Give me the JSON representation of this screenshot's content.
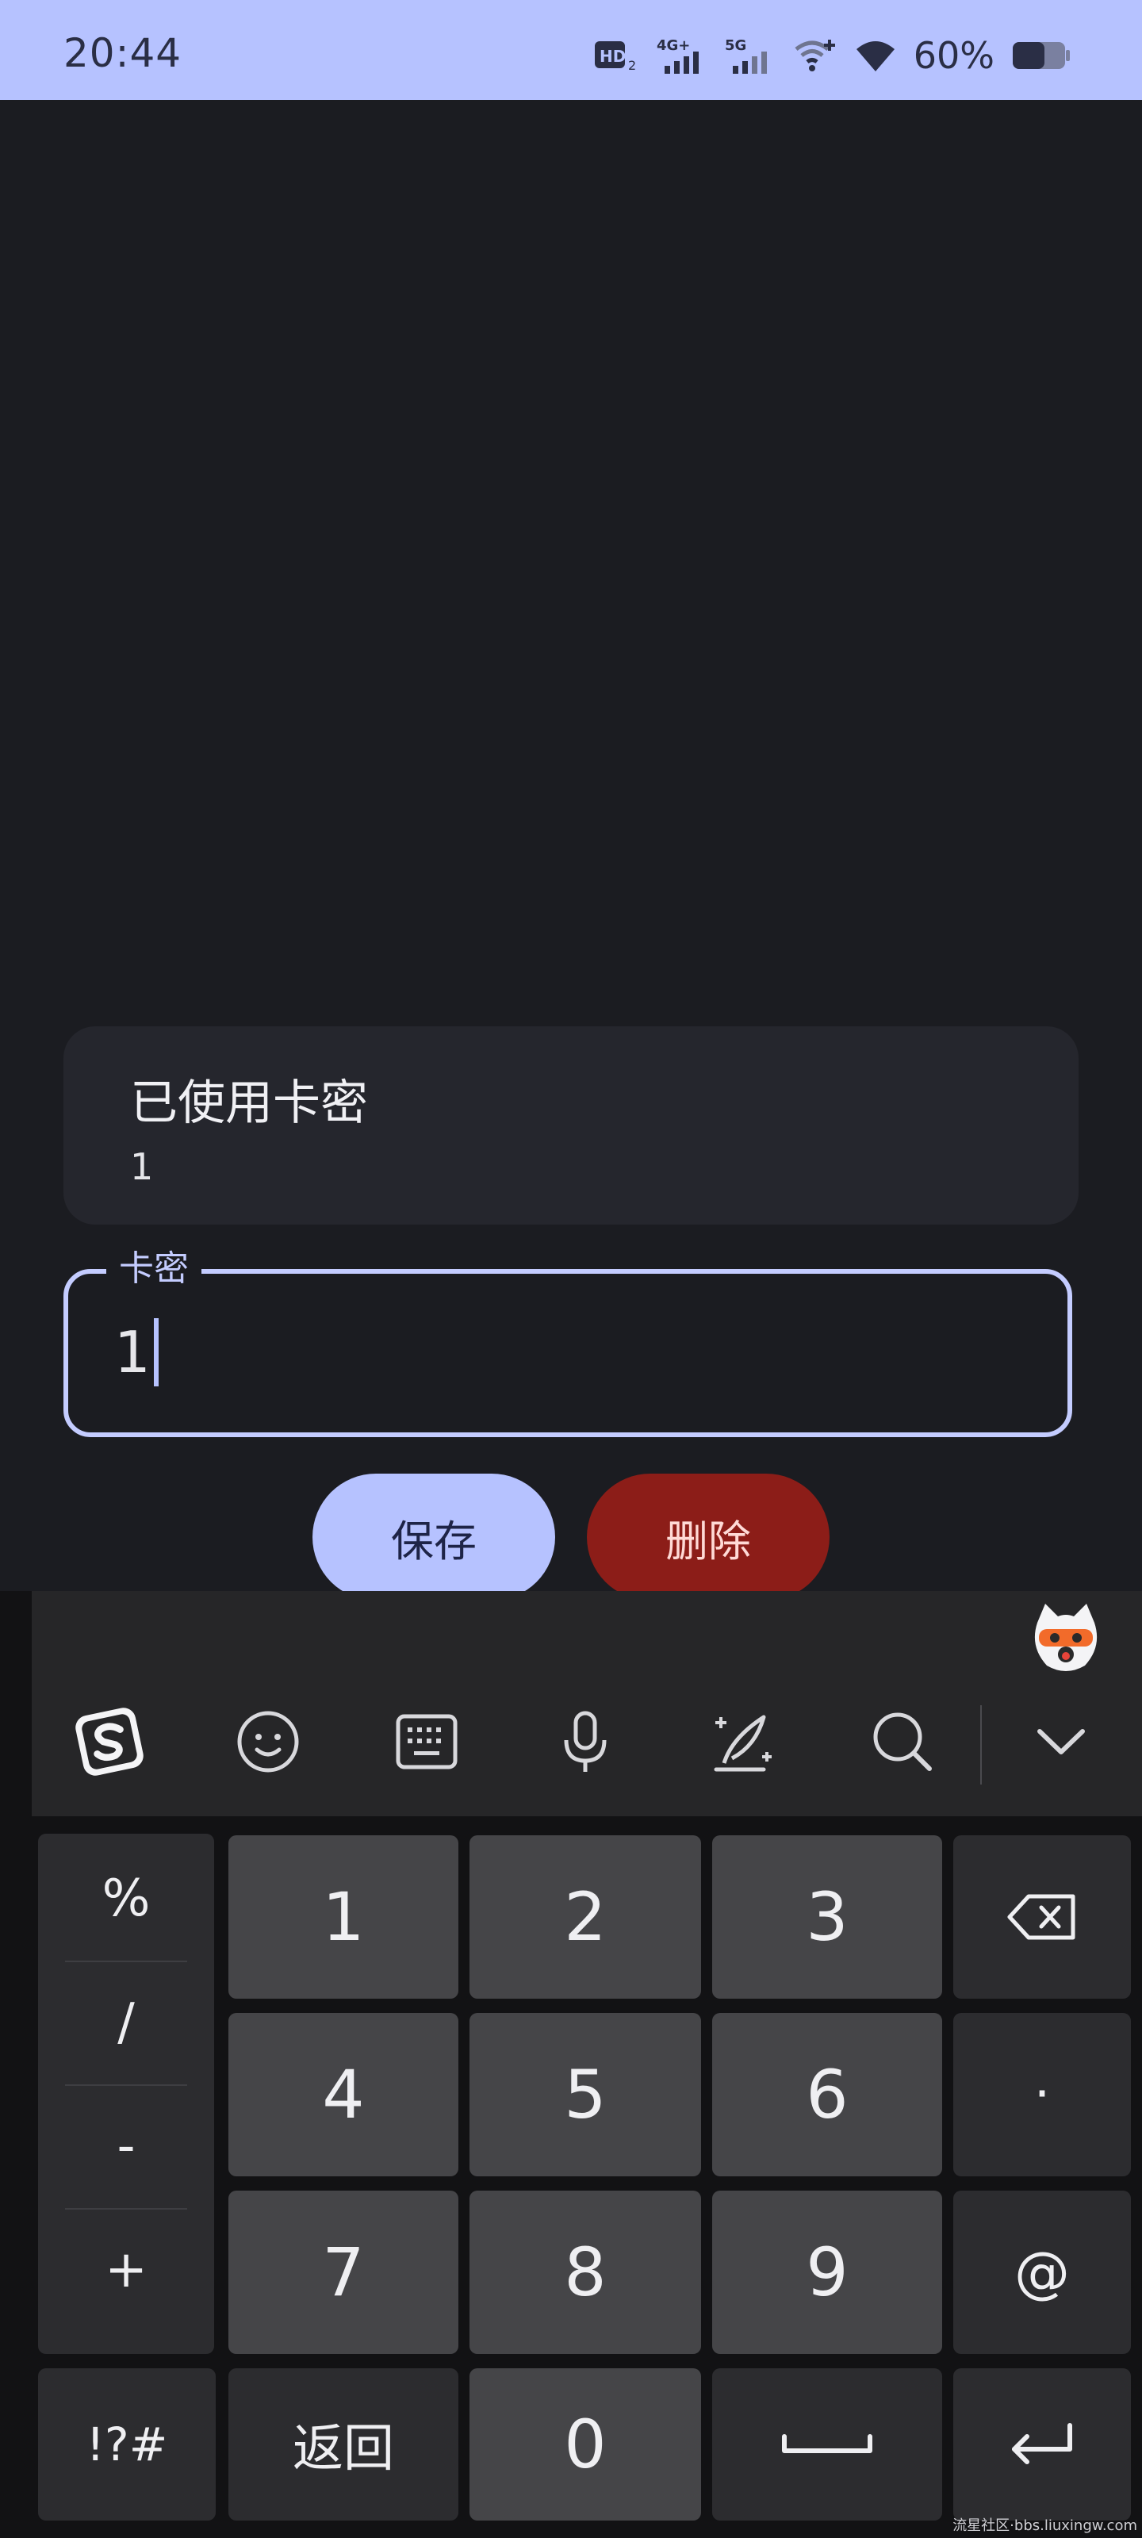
{
  "status_bar": {
    "time": "20:44",
    "battery": "60%",
    "icons": [
      "hd-icon",
      "4g-signal-icon",
      "5g-signal-icon",
      "wifi-plus-icon",
      "wifi-icon",
      "battery-icon"
    ]
  },
  "card": {
    "title": "已使用卡密",
    "value": "1"
  },
  "field": {
    "label": "卡密",
    "value": "1"
  },
  "buttons": {
    "save": "保存",
    "delete": "删除"
  },
  "keyboard": {
    "toolbar_icons": [
      "sogou-logo-icon",
      "emoji-icon",
      "keyboard-icon",
      "microphone-icon",
      "handwriting-icon",
      "search-icon",
      "collapse-chevron-icon"
    ],
    "symbols": [
      "%",
      "/",
      "-",
      "+"
    ],
    "rows": [
      [
        "1",
        "2",
        "3"
      ],
      [
        "4",
        "5",
        "6"
      ],
      [
        "7",
        "8",
        "9"
      ]
    ],
    "dot": "·",
    "at": "@",
    "sym_key": "!?#",
    "back_key": "返回",
    "zero": "0"
  },
  "watermark": "流星社区·bbs.liuxingw.com",
  "colors": {
    "accent": "#b6c2ff",
    "delete": "#8c1d18",
    "background": "#1b1c21"
  }
}
